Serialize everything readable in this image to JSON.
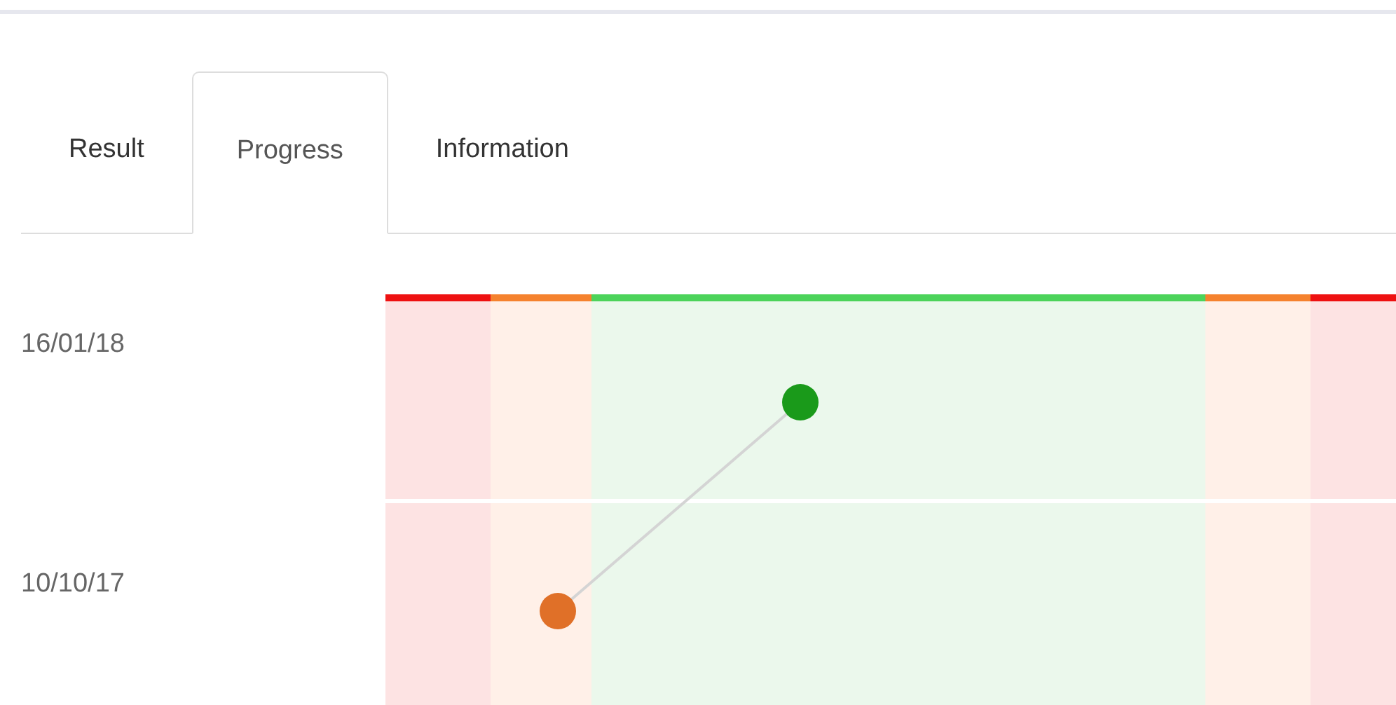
{
  "tabs": [
    {
      "label": "Result",
      "selected": false
    },
    {
      "label": "Progress",
      "selected": true
    },
    {
      "label": "Information",
      "selected": false
    }
  ],
  "rows": [
    {
      "date": "16/01/18",
      "color": "#1a9a1a"
    },
    {
      "date": "10/10/17",
      "color": "#e07028"
    }
  ]
}
